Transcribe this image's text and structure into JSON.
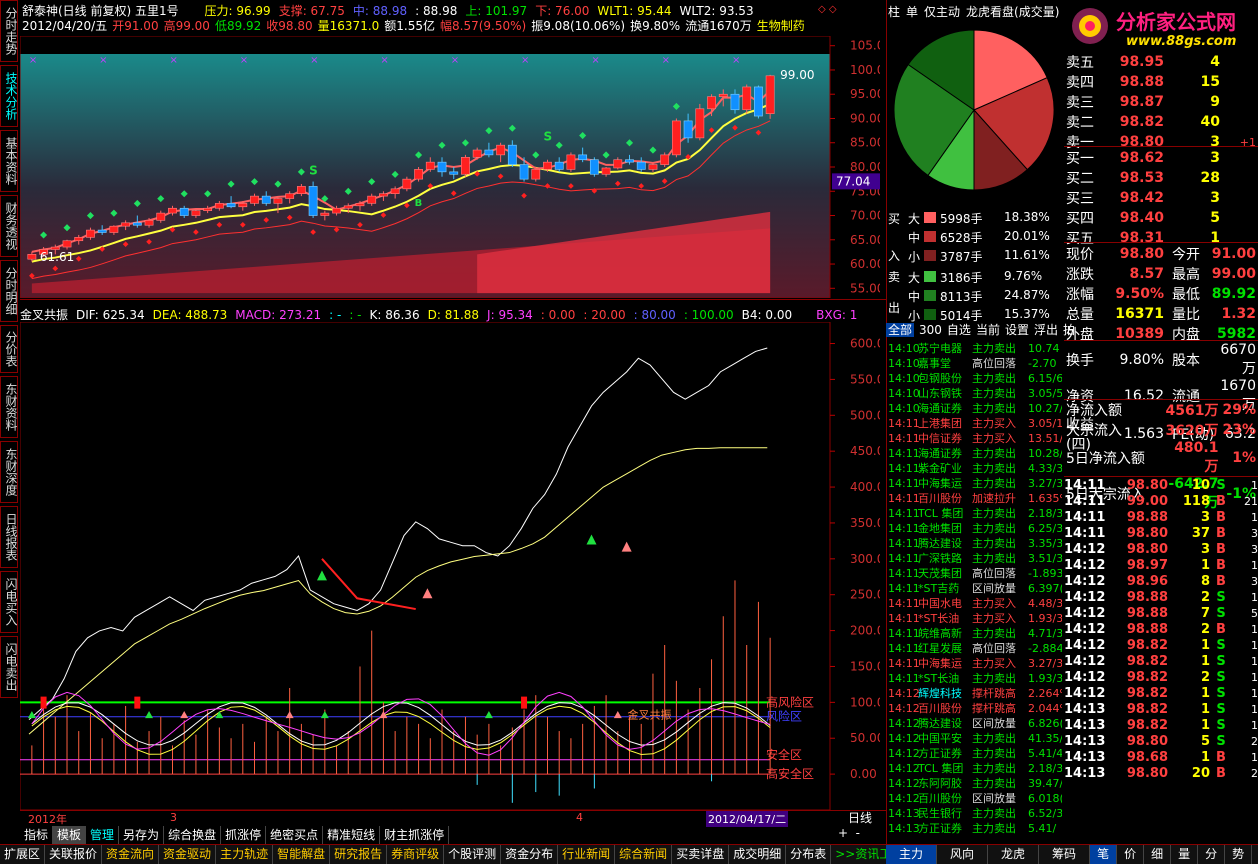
{
  "title": "舒泰神(日线 前复权) 五里1号",
  "topline": [
    {
      "t": "压力: 96.99",
      "c": "y"
    },
    {
      "t": "支撑: 67.75",
      "c": "r"
    },
    {
      "t": "中: 88.98",
      "c": "b"
    },
    {
      "t": ": 88.98",
      "c": "w"
    },
    {
      "t": "上: 101.97",
      "c": "g"
    },
    {
      "t": "下: 76.00",
      "c": "r"
    },
    {
      "t": "WLT1: 95.44",
      "c": "y"
    },
    {
      "t": "WLT2: 93.53",
      "c": "w"
    }
  ],
  "infoline": [
    {
      "t": "2012/04/20/五",
      "c": "w"
    },
    {
      "t": "开91.00",
      "c": "r"
    },
    {
      "t": "高99.00",
      "c": "r"
    },
    {
      "t": "低89.92",
      "c": "g"
    },
    {
      "t": "收98.80",
      "c": "r"
    },
    {
      "t": "量16371.0",
      "c": "y"
    },
    {
      "t": "额1.55亿",
      "c": "w"
    },
    {
      "t": "幅8.57(9.50%)",
      "c": "r"
    },
    {
      "t": "振9.08(10.06%)",
      "c": "w"
    },
    {
      "t": "换9.80%",
      "c": "w"
    },
    {
      "t": "流通1670万",
      "c": "w"
    },
    {
      "t": "生物制药",
      "c": "y"
    }
  ],
  "price_axis": [
    "105.00",
    "100.00",
    "95.00",
    "90.00",
    "85.00",
    "80.00",
    "75.00",
    "70.00",
    "65.00",
    "60.00",
    "55.00"
  ],
  "price_marker": "77.04",
  "high_label": "99.00",
  "low_label": "61.61",
  "sig_s": "S",
  "sig_b": "B",
  "ind_line": [
    {
      "t": "金叉共振",
      "c": "w"
    },
    {
      "t": "DIF: 625.34",
      "c": "w"
    },
    {
      "t": "DEA: 488.73",
      "c": "y"
    },
    {
      "t": "MACD: 273.21",
      "c": "m"
    },
    {
      "t": ": -",
      "c": "c"
    },
    {
      "t": ": -",
      "c": "g"
    },
    {
      "t": "K: 86.36",
      "c": "w"
    },
    {
      "t": "D: 81.88",
      "c": "y"
    },
    {
      "t": "J: 95.34",
      "c": "m"
    },
    {
      "t": ": 0.00",
      "c": "r"
    },
    {
      "t": ": 20.00",
      "c": "r"
    },
    {
      "t": ": 80.00",
      "c": "b"
    },
    {
      "t": ": 100.00",
      "c": "g"
    },
    {
      "t": "B4: 0.00",
      "c": "w"
    },
    {
      "t": "BXG: 1",
      "c": "m"
    }
  ],
  "ind_axis": [
    "600.00",
    "550.00",
    "500.00",
    "450.00",
    "400.00",
    "350.00",
    "300.00",
    "250.00",
    "200.00",
    "150.00",
    "100.00",
    "50.00",
    "0.00"
  ],
  "zones": {
    "high": "高风险区",
    "risk": "风险区",
    "safe": "安全区",
    "very_safe": "高安全区",
    "cross": "金叉共振"
  },
  "date_axis": {
    "year": "2012年",
    "m3": "3",
    "m4": "4",
    "cursor": "2012/04/17/二",
    "period": "日线"
  },
  "left_tabs": [
    "分时走势",
    "技术分析",
    "基本资料",
    "财务透视",
    "分时明细",
    "分价表",
    "东财资料",
    "东财深度",
    "日线报表",
    "闪电买入",
    "闪电卖出"
  ],
  "bottom_tabs": [
    "指标",
    "模板",
    "管理",
    "另存为",
    "综合换盘",
    "抓涨停",
    "绝密买点",
    "精准短线",
    "财主抓涨停"
  ],
  "bottom_bar": [
    "扩展区",
    "关联报价",
    "资金流向",
    "资金驱动",
    "主力轨迹",
    "智能解盘",
    "研究报告",
    "券商评级",
    "个股评测",
    "资金分布",
    "行业新闻",
    "综合新闻",
    "买卖详盘",
    "成交明细",
    "分布表",
    ">>资讯工场"
  ],
  "right_bottom_tabs": [
    "主力",
    "风向",
    "龙虎",
    "筹码",
    "笔",
    "价",
    "细",
    "量",
    "分",
    "势",
    "指",
    "联"
  ],
  "pie_tabs": [
    "柱",
    "单",
    "仅主动",
    "龙虎看盘(成交量)"
  ],
  "flow_side": {
    "buy1": "买",
    "buy2": "入",
    "sell1": "卖",
    "sell2": "出"
  },
  "flow": [
    {
      "k": "大",
      "v": "5998手",
      "p": "18.38%",
      "col": "#ff6060"
    },
    {
      "k": "中",
      "v": "6528手",
      "p": "20.01%",
      "col": "#c03030"
    },
    {
      "k": "小",
      "v": "3787手",
      "p": "11.61%",
      "col": "#802020"
    },
    {
      "k": "大",
      "v": "3186手",
      "p": "9.76%",
      "col": "#40c040"
    },
    {
      "k": "中",
      "v": "8113手",
      "p": "24.87%",
      "col": "#208020"
    },
    {
      "k": "小",
      "v": "5014手",
      "p": "15.37%",
      "col": "#106010"
    }
  ],
  "news_tabs": [
    "全部",
    "300",
    "自选",
    "当前",
    "设置",
    "浮出",
    "拍"
  ],
  "news": [
    [
      "14:10",
      "苏宁电器",
      "主力卖出",
      "10.74"
    ],
    [
      "14:10",
      "嘉事堂",
      "高位回落",
      "-2.70"
    ],
    [
      "14:10",
      "包钢股份",
      "主力卖出",
      "6.15/6"
    ],
    [
      "14:10",
      "山东钢铁",
      "主力卖出",
      "3.05/5"
    ],
    [
      "14:10",
      "海通证券",
      "主力卖出",
      "10.27/"
    ],
    [
      "14:11",
      "上港集团",
      "主力买入",
      "3.05/1"
    ],
    [
      "14:11",
      "中信证券",
      "主力买入",
      "13.51/"
    ],
    [
      "14:11",
      "海通证券",
      "主力卖出",
      "10.28/"
    ],
    [
      "14:11",
      "紫金矿业",
      "主力卖出",
      "4.33/3"
    ],
    [
      "14:11",
      "中海集运",
      "主力卖出",
      "3.27/3"
    ],
    [
      "14:11",
      "百川股份",
      "加速拉升",
      "1.635%"
    ],
    [
      "14:11",
      "TCL 集团",
      "主力卖出",
      "2.18/3"
    ],
    [
      "14:11",
      "金地集团",
      "主力卖出",
      "6.25/3"
    ],
    [
      "14:11",
      "腾达建设",
      "主力卖出",
      "3.35/3"
    ],
    [
      "14:11",
      "广深铁路",
      "主力卖出",
      "3.51/3"
    ],
    [
      "14:11",
      "天茂集团",
      "高位回落",
      "-1.893"
    ],
    [
      "14:11",
      "*ST吉药",
      "区间放量",
      "6.397("
    ],
    [
      "14:11",
      "中国水电",
      "主力买入",
      "4.48/3"
    ],
    [
      "14:11",
      "*ST长油",
      "主力买入",
      "1.93/3"
    ],
    [
      "14:11",
      "皖维高新",
      "主力卖出",
      "4.71/3"
    ],
    [
      "14:11",
      "红星发展",
      "高位回落",
      "-2.884"
    ],
    [
      "14:11",
      "中海集运",
      "主力买入",
      "3.27/3"
    ],
    [
      "14:11",
      "*ST长油",
      "主力卖出",
      "1.93/3"
    ],
    [
      "14:12",
      "辉煌科技",
      "撑杆跳高",
      "2.264%"
    ],
    [
      "14:12",
      "百川股份",
      "撑杆跳高",
      "2.044%"
    ],
    [
      "14:12",
      "腾达建设",
      "区间放量",
      "6.826("
    ],
    [
      "14:12",
      "中国平安",
      "主力卖出",
      "41.35/"
    ],
    [
      "14:12",
      "方正证券",
      "主力卖出",
      "5.41/4"
    ],
    [
      "14:12",
      "TCL 集团",
      "主力卖出",
      "2.18/3"
    ],
    [
      "14:12",
      "东阿阿胶",
      "主力卖出",
      "39.47/"
    ],
    [
      "14:12",
      "百川股份",
      "区间放量",
      "6.018("
    ],
    [
      "14:13",
      "民生银行",
      "主力卖出",
      "6.52/3"
    ],
    [
      "14:13",
      "方正证券",
      "主力卖出",
      "5.41/"
    ]
  ],
  "quotes": {
    "asks": [
      {
        "n": "卖五",
        "p": "98.95",
        "v": "4",
        "x": ""
      },
      {
        "n": "卖四",
        "p": "98.88",
        "v": "15",
        "x": ""
      },
      {
        "n": "卖三",
        "p": "98.87",
        "v": "9",
        "x": ""
      },
      {
        "n": "卖二",
        "p": "98.82",
        "v": "40",
        "x": ""
      },
      {
        "n": "卖一",
        "p": "98.80",
        "v": "3",
        "x": "+1"
      }
    ],
    "bids": [
      {
        "n": "买一",
        "p": "98.62",
        "v": "3",
        "x": ""
      },
      {
        "n": "买二",
        "p": "98.53",
        "v": "28",
        "x": ""
      },
      {
        "n": "买三",
        "p": "98.42",
        "v": "3",
        "x": ""
      },
      {
        "n": "买四",
        "p": "98.40",
        "v": "5",
        "x": ""
      },
      {
        "n": "买五",
        "p": "98.31",
        "v": "1",
        "x": ""
      }
    ]
  },
  "stats": [
    {
      "a": "现价",
      "av": "98.80",
      "ac": "r",
      "b": "今开",
      "bv": "91.00",
      "bc": "r"
    },
    {
      "a": "涨跌",
      "av": "8.57",
      "ac": "r",
      "b": "最高",
      "bv": "99.00",
      "bc": "r"
    },
    {
      "a": "涨幅",
      "av": "9.50%",
      "ac": "r",
      "b": "最低",
      "bv": "89.92",
      "bc": "g"
    },
    {
      "a": "总量",
      "av": "16371",
      "ac": "y",
      "b": "量比",
      "bv": "1.32",
      "bc": "r"
    },
    {
      "a": "外盘",
      "av": "10389",
      "ac": "r",
      "b": "内盘",
      "bv": "5982",
      "bc": "g"
    }
  ],
  "stats2": [
    {
      "a": "换手",
      "av": "9.80%",
      "b": "股本",
      "bv": "6670万"
    },
    {
      "a": "净资",
      "av": "16.52",
      "b": "流通",
      "bv": "1670万"
    },
    {
      "a": "收益(四)",
      "av": "1.563",
      "b": "PE(动)",
      "bv": "63.2"
    }
  ],
  "flows": [
    {
      "a": "净流入额",
      "v": "4561万",
      "p": "29%",
      "c": "r"
    },
    {
      "a": "大宗流入",
      "v": "3620万",
      "p": "23%",
      "c": "r"
    },
    {
      "a": "5日净流入额",
      "v": "480.1万",
      "p": "1%",
      "c": "r"
    },
    {
      "a": "5日大宗流入",
      "v": "-642.7万",
      "p": "-1%",
      "c": "g"
    }
  ],
  "ticks": [
    [
      "14:11",
      "98.80",
      "10",
      "S",
      "1",
      "g"
    ],
    [
      "14:11",
      "99.00",
      "118",
      "B",
      "21",
      "r"
    ],
    [
      "14:11",
      "98.88",
      "3",
      "B",
      "1",
      "r"
    ],
    [
      "14:11",
      "98.80",
      "37",
      "B",
      "3",
      "r"
    ],
    [
      "14:12",
      "98.80",
      "3",
      "B",
      "3",
      "r"
    ],
    [
      "14:12",
      "98.97",
      "1",
      "B",
      "1",
      "r"
    ],
    [
      "14:12",
      "98.96",
      "8",
      "B",
      "3",
      "r"
    ],
    [
      "14:12",
      "98.88",
      "2",
      "S",
      "1",
      "g"
    ],
    [
      "14:12",
      "98.88",
      "7",
      "S",
      "5",
      "g"
    ],
    [
      "14:12",
      "98.88",
      "2",
      "B",
      "1",
      "r"
    ],
    [
      "14:12",
      "98.82",
      "1",
      "S",
      "1",
      "g"
    ],
    [
      "14:12",
      "98.82",
      "1",
      "S",
      "1",
      "g"
    ],
    [
      "14:12",
      "98.82",
      "2",
      "S",
      "1",
      "g"
    ],
    [
      "14:12",
      "98.82",
      "1",
      "S",
      "1",
      "g"
    ],
    [
      "14:13",
      "98.82",
      "1",
      "S",
      "1",
      "g"
    ],
    [
      "14:13",
      "98.82",
      "1",
      "S",
      "1",
      "g"
    ],
    [
      "14:13",
      "98.80",
      "5",
      "S",
      "2",
      "g"
    ],
    [
      "14:13",
      "98.68",
      "1",
      "B",
      "1",
      "r"
    ],
    [
      "14:13",
      "98.80",
      "20",
      "B",
      "2",
      "r"
    ]
  ],
  "logo": {
    "title": "分析家公式网",
    "url": "www.88gs.com"
  },
  "chart_data": {
    "type": "candlestick",
    "title": "舒泰神(日线 前复权) 五里1号",
    "ylim": [
      53,
      107
    ],
    "candles": [
      [
        61,
        62.5,
        60.5,
        62
      ],
      [
        62,
        63.5,
        61.5,
        63
      ],
      [
        63,
        64,
        62,
        63.5
      ],
      [
        63.5,
        65,
        63,
        64.8
      ],
      [
        64.8,
        66,
        64,
        65.5
      ],
      [
        65.5,
        67.5,
        65,
        67
      ],
      [
        67,
        68,
        66,
        66.5
      ],
      [
        66.5,
        68,
        66,
        67.8
      ],
      [
        67.8,
        69,
        67,
        68.5
      ],
      [
        68.5,
        70,
        67.5,
        68
      ],
      [
        68,
        69.5,
        67.5,
        69
      ],
      [
        69,
        71,
        68.5,
        70.5
      ],
      [
        70.5,
        72,
        70,
        71.5
      ],
      [
        71.5,
        72,
        69.5,
        70
      ],
      [
        70,
        71.5,
        69.5,
        71
      ],
      [
        71,
        72,
        70.5,
        71.5
      ],
      [
        71.5,
        73,
        71,
        72.5
      ],
      [
        72.5,
        74,
        71.5,
        71.8
      ],
      [
        71.8,
        73,
        71,
        72.5
      ],
      [
        72.5,
        74.5,
        72,
        74
      ],
      [
        74,
        75,
        72,
        72.5
      ],
      [
        72.5,
        74,
        70.5,
        73.5
      ],
      [
        73.5,
        75,
        72.5,
        74.5
      ],
      [
        74.5,
        76.5,
        74,
        76
      ],
      [
        76,
        77,
        69.5,
        70
      ],
      [
        70,
        71,
        69,
        70.5
      ],
      [
        70.5,
        72,
        70,
        71.5
      ],
      [
        71.5,
        72.5,
        70.5,
        72
      ],
      [
        72,
        73,
        71,
        72.5
      ],
      [
        72.5,
        74.5,
        72,
        74
      ],
      [
        74,
        75,
        73,
        74.5
      ],
      [
        74.5,
        76,
        73.5,
        75.5
      ],
      [
        75.5,
        78,
        75,
        77.5
      ],
      [
        77.5,
        80,
        77,
        79.5
      ],
      [
        79.5,
        82,
        79,
        81
      ],
      [
        81,
        82,
        78,
        79
      ],
      [
        79,
        80,
        77.5,
        78.5
      ],
      [
        78.5,
        82.5,
        78,
        82
      ],
      [
        82,
        84,
        81.5,
        83.5
      ],
      [
        83.5,
        85,
        82,
        82.5
      ],
      [
        82.5,
        85,
        81,
        84.5
      ],
      [
        84.5,
        85.5,
        80,
        80.5
      ],
      [
        80.5,
        82,
        77,
        77.5
      ],
      [
        77.5,
        80,
        77,
        79.5
      ],
      [
        79.5,
        81.5,
        79,
        81
      ],
      [
        81,
        82,
        79,
        79.5
      ],
      [
        79.5,
        83,
        79,
        82.5
      ],
      [
        82.5,
        84,
        81,
        81.5
      ],
      [
        81.5,
        82,
        78,
        78.5
      ],
      [
        78.5,
        80,
        78,
        79.8
      ],
      [
        79.8,
        82,
        79.5,
        81.5
      ],
      [
        81.5,
        82.5,
        80.5,
        81
      ],
      [
        81,
        82,
        79,
        79.5
      ],
      [
        79.5,
        81,
        79,
        80.5
      ],
      [
        80.5,
        83,
        80,
        82.5
      ],
      [
        82.5,
        90,
        82,
        89.5
      ],
      [
        89.5,
        91,
        85,
        86
      ],
      [
        86,
        93,
        85.5,
        92
      ],
      [
        92,
        95,
        90.5,
        94.5
      ],
      [
        94.5,
        96,
        92.5,
        95
      ],
      [
        95,
        96,
        91,
        91.8
      ],
      [
        91.8,
        97,
        91,
        96.5
      ],
      [
        96.5,
        96.8,
        90,
        90.5
      ],
      [
        91,
        99,
        89.92,
        98.8
      ]
    ]
  }
}
